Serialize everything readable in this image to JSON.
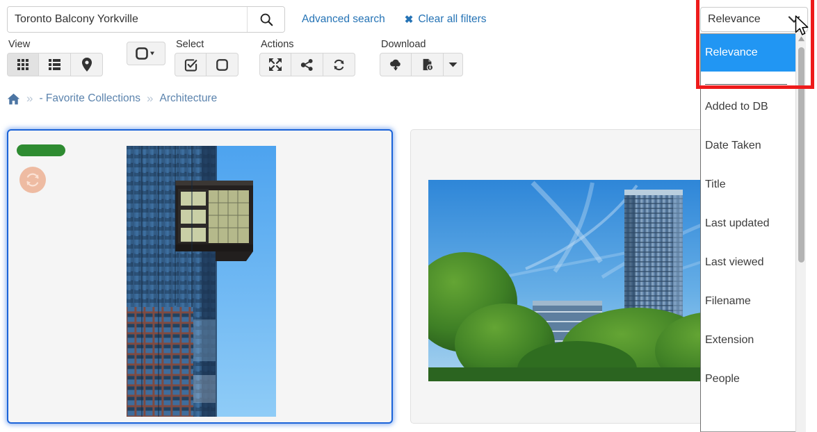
{
  "search": {
    "query": "Toronto Balcony Yorkville",
    "placeholder": "Search",
    "search_icon": "magnifier-icon",
    "advanced_label": "Advanced search",
    "clear_label": "Clear all filters",
    "clear_icon": "x-mark-icon"
  },
  "toolbar": {
    "groups": [
      {
        "label": "View",
        "buttons": [
          {
            "name": "view-grid",
            "icon": "grid-icon",
            "active": true
          },
          {
            "name": "view-list",
            "icon": "list-icon",
            "active": false
          },
          {
            "name": "view-map",
            "icon": "map-pin-icon",
            "active": false
          }
        ]
      },
      {
        "label": "",
        "buttons": [
          {
            "name": "thumb-size",
            "icon": "rounded-square-caret-icon",
            "active": false
          }
        ]
      },
      {
        "label": "Select",
        "buttons": [
          {
            "name": "select-all",
            "icon": "checked-square-icon",
            "active": false
          },
          {
            "name": "select-none",
            "icon": "empty-square-icon",
            "active": false
          }
        ]
      },
      {
        "label": "Actions",
        "buttons": [
          {
            "name": "expand",
            "icon": "expand-arrows-icon",
            "active": false
          },
          {
            "name": "share",
            "icon": "share-nodes-icon",
            "active": false
          },
          {
            "name": "refresh",
            "icon": "refresh-icon",
            "active": false
          }
        ]
      },
      {
        "label": "Download",
        "buttons": [
          {
            "name": "download-cloud",
            "icon": "cloud-download-icon",
            "active": false
          },
          {
            "name": "download-file",
            "icon": "file-download-icon",
            "active": false
          },
          {
            "name": "download-menu",
            "icon": "caret-down-icon",
            "active": false
          }
        ]
      }
    ]
  },
  "breadcrumb": {
    "home_icon": "home-icon",
    "separator": "»",
    "items": [
      {
        "label": "- Favorite Collections"
      },
      {
        "label": "Architecture"
      }
    ]
  },
  "results": {
    "cards": [
      {
        "name": "result-card-1",
        "selected": true,
        "badge_color": "#2e8b31",
        "status_icon": "refresh-circle-icon",
        "status_icon_color": "#eebba2",
        "image_alt": "glass skyscraper with cantilevered balcony against blue sky"
      },
      {
        "name": "result-card-2",
        "selected": false,
        "image_alt": "blue sky with contrails over green trees and condo towers"
      }
    ]
  },
  "sort": {
    "selected": "Relevance",
    "chevron_icon": "chevron-down-icon",
    "options": [
      "Relevance",
      "Added to DB",
      "Date Taken",
      "Title",
      "Last updated",
      "Last viewed",
      "Filename",
      "Extension",
      "People"
    ],
    "scrollbar_up_icon": "scroll-up-arrow-icon"
  },
  "annotation": {
    "highlight_color": "#ee1b1b",
    "cursor_icon": "mouse-pointer-icon"
  },
  "colors": {
    "link": "#2573b5",
    "selection_blue": "#2196f3",
    "card_selected_border": "#1a63d8"
  }
}
